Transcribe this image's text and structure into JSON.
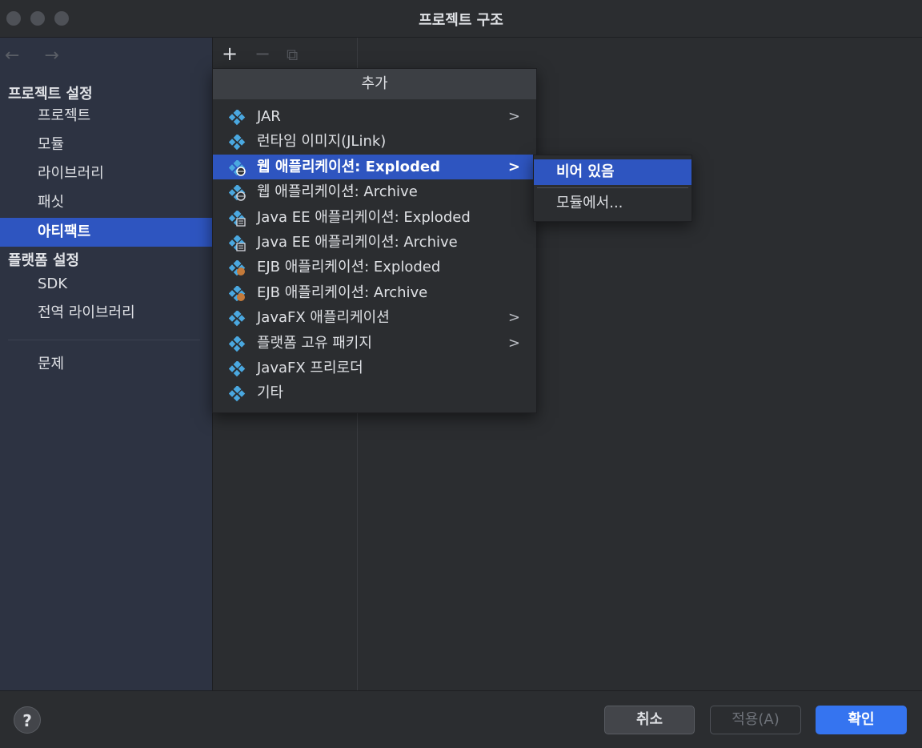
{
  "window": {
    "title": "프로젝트 구조"
  },
  "sidebar": {
    "nav": "← →",
    "project_settings_header": "프로젝트 설정",
    "platform_settings_header": "플랫폼 설정",
    "project_items": [
      "프로젝트",
      "모듈",
      "라이브러리",
      "패싯",
      "아티팩트"
    ],
    "platform_items": [
      "SDK",
      "전역 라이브러리"
    ],
    "problems": "문제",
    "selected": "아티팩트"
  },
  "toolbar": {
    "add": "+",
    "remove": "−",
    "copy": "⧉"
  },
  "popup": {
    "title": "추가",
    "items": [
      {
        "label": "JAR",
        "has_submenu": true,
        "icon": "artifact-icon"
      },
      {
        "label": "런타임 이미지(JLink)",
        "has_submenu": false,
        "icon": "artifact-icon"
      },
      {
        "label": "웹 애플리케이션: Exploded",
        "has_submenu": true,
        "icon": "web-artifact-icon",
        "highlighted": true
      },
      {
        "label": "웹 애플리케이션: Archive",
        "has_submenu": false,
        "icon": "web-artifact-icon"
      },
      {
        "label": "Java EE 애플리케이션: Exploded",
        "has_submenu": false,
        "icon": "javaee-artifact-icon"
      },
      {
        "label": "Java EE 애플리케이션: Archive",
        "has_submenu": false,
        "icon": "javaee-artifact-icon"
      },
      {
        "label": "EJB 애플리케이션: Exploded",
        "has_submenu": false,
        "icon": "ejb-artifact-icon"
      },
      {
        "label": "EJB 애플리케이션: Archive",
        "has_submenu": false,
        "icon": "ejb-artifact-icon"
      },
      {
        "label": "JavaFX 애플리케이션",
        "has_submenu": true,
        "icon": "artifact-icon"
      },
      {
        "label": "플랫폼 고유 패키지",
        "has_submenu": true,
        "icon": "artifact-icon"
      },
      {
        "label": "JavaFX 프리로더",
        "has_submenu": false,
        "icon": "artifact-icon"
      },
      {
        "label": "기타",
        "has_submenu": false,
        "icon": "artifact-icon"
      }
    ],
    "arrow": ">"
  },
  "submenu": {
    "items": [
      "비어 있음",
      "모듈에서..."
    ],
    "highlighted": "비어 있음"
  },
  "footer": {
    "help": "?",
    "cancel": "취소",
    "apply": "적용(A)",
    "ok": "확인"
  },
  "colors": {
    "selection": "#2e55c0",
    "sidebar_bg": "#2d3342",
    "panel_bg": "#2b2d30",
    "ok_button": "#3574f0",
    "icon_blue": "#4aa8e0"
  }
}
